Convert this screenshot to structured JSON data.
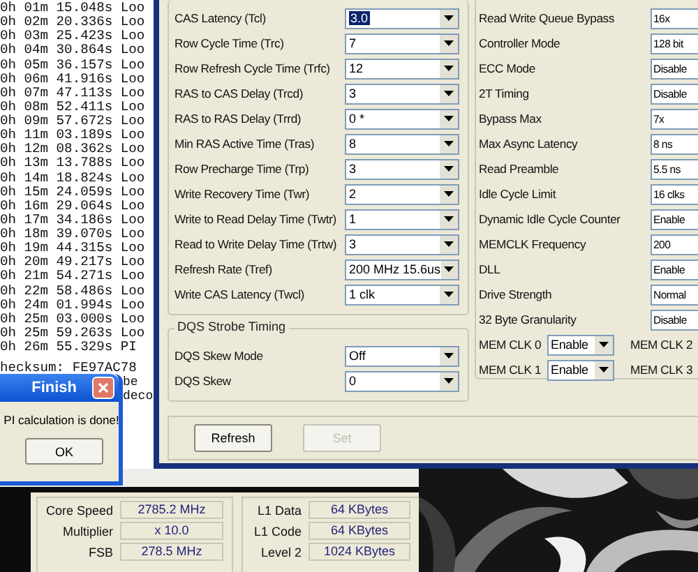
{
  "console": {
    "lines": [
      "0h 01m 15.048s Loo",
      "0h 02m 20.336s Loo",
      "0h 03m 25.423s Loo",
      "0h 04m 30.864s Loo",
      "0h 05m 36.157s Loo",
      "0h 06m 41.916s Loo",
      "0h 07m 47.113s Loo",
      "0h 08m 52.411s Loo",
      "0h 09m 57.672s Loo",
      "0h 11m 03.189s Loo",
      "0h 12m 08.362s Loo",
      "0h 13m 13.788s Loo",
      "0h 14m 18.824s Loo",
      "0h 15m 24.059s Loo",
      "0h 16m 29.064s Loo",
      "0h 17m 34.186s Loo",
      "0h 18m 39.070s Loo",
      "0h 19m 44.315s Loo",
      "0h 20m 49.217s Loo",
      "0h 21m 54.271s Loo",
      "0h 22m 58.486s Loo",
      "0h 24m 01.994s Loo",
      "0h 25m 03.000s Loo",
      "0h 25m 59.263s Loo",
      "0h 26m 55.329s PI"
    ],
    "checksum": "hecksum: FE97AC78",
    "fragments": [
      "be",
      "deco"
    ]
  },
  "timing_dialog": {
    "timings": [
      {
        "label": "CAS Latency (Tcl)",
        "value": "3.0",
        "focused": true
      },
      {
        "label": "Row Cycle Time (Trc)",
        "value": "7",
        "focused": false
      },
      {
        "label": "Row Refresh Cycle Time (Trfc)",
        "value": "12",
        "focused": false
      },
      {
        "label": "RAS to CAS Delay (Trcd)",
        "value": "3",
        "focused": false
      },
      {
        "label": "RAS to RAS Delay (Trrd)",
        "value": "0 *",
        "focused": false
      },
      {
        "label": "Min RAS Active Time (Tras)",
        "value": "8",
        "focused": false
      },
      {
        "label": "Row Precharge Time (Trp)",
        "value": "3",
        "focused": false
      },
      {
        "label": "Write Recovery Time (Twr)",
        "value": "2",
        "focused": false
      },
      {
        "label": "Write to Read Delay Time (Twtr)",
        "value": "1",
        "focused": false
      },
      {
        "label": "Read to Write Delay Time (Trtw)",
        "value": "3",
        "focused": false
      },
      {
        "label": "Refresh Rate (Tref)",
        "value": "200 MHz 15.6us",
        "focused": false
      },
      {
        "label": "Write CAS Latency (Twcl)",
        "value": "1 clk",
        "focused": false
      }
    ],
    "dqs_group": {
      "title": "DQS Strobe Timing",
      "settings": [
        {
          "label": "DQS Skew Mode",
          "value": "Off"
        },
        {
          "label": "DQS Skew",
          "value": "0"
        }
      ]
    },
    "controller": [
      {
        "label": "Read Write Queue Bypass",
        "value": "16x"
      },
      {
        "label": "Controller Mode",
        "value": "128 bit"
      },
      {
        "label": "ECC Mode",
        "value": "Disable"
      },
      {
        "label": "2T Timing",
        "value": "Disable"
      },
      {
        "label": "Bypass Max",
        "value": "7x"
      },
      {
        "label": "Max Async Latency",
        "value": "8 ns"
      },
      {
        "label": "Read Preamble",
        "value": "5.5 ns"
      },
      {
        "label": "Idle Cycle Limit",
        "value": "16 clks"
      },
      {
        "label": "Dynamic Idle Cycle Counter",
        "value": "Enable"
      },
      {
        "label": "MEMCLK Frequency",
        "value": "200"
      },
      {
        "label": "DLL",
        "value": "Enable"
      },
      {
        "label": "Drive Strength",
        "value": "Normal"
      },
      {
        "label": "32 Byte Granularity",
        "value": "Disable"
      }
    ],
    "mem_clks": [
      {
        "label": "MEM CLK 0",
        "value": "Enable",
        "label_2": "MEM CLK 2"
      },
      {
        "label": "MEM CLK 1",
        "value": "Enable",
        "label_2": "MEM CLK 3"
      }
    ],
    "buttons": [
      {
        "label": "Refresh",
        "disabled": false
      },
      {
        "label": "Set",
        "disabled": true
      }
    ]
  },
  "finish_dialog": {
    "title": "Finish",
    "message": "PI calculation is done!",
    "button": "OK"
  },
  "cpu_panel": {
    "clocks": [
      {
        "label": "Core Speed",
        "value": "2785.2 MHz"
      },
      {
        "label": "Multiplier",
        "value": "x 10.0"
      },
      {
        "label": "FSB",
        "value": "278.5 MHz"
      }
    ],
    "cache": [
      {
        "label": "L1 Data",
        "value": "64 KBytes"
      },
      {
        "label": "L1 Code",
        "value": "64 KBytes"
      },
      {
        "label": "Level 2",
        "value": "1024 KBytes"
      }
    ]
  }
}
